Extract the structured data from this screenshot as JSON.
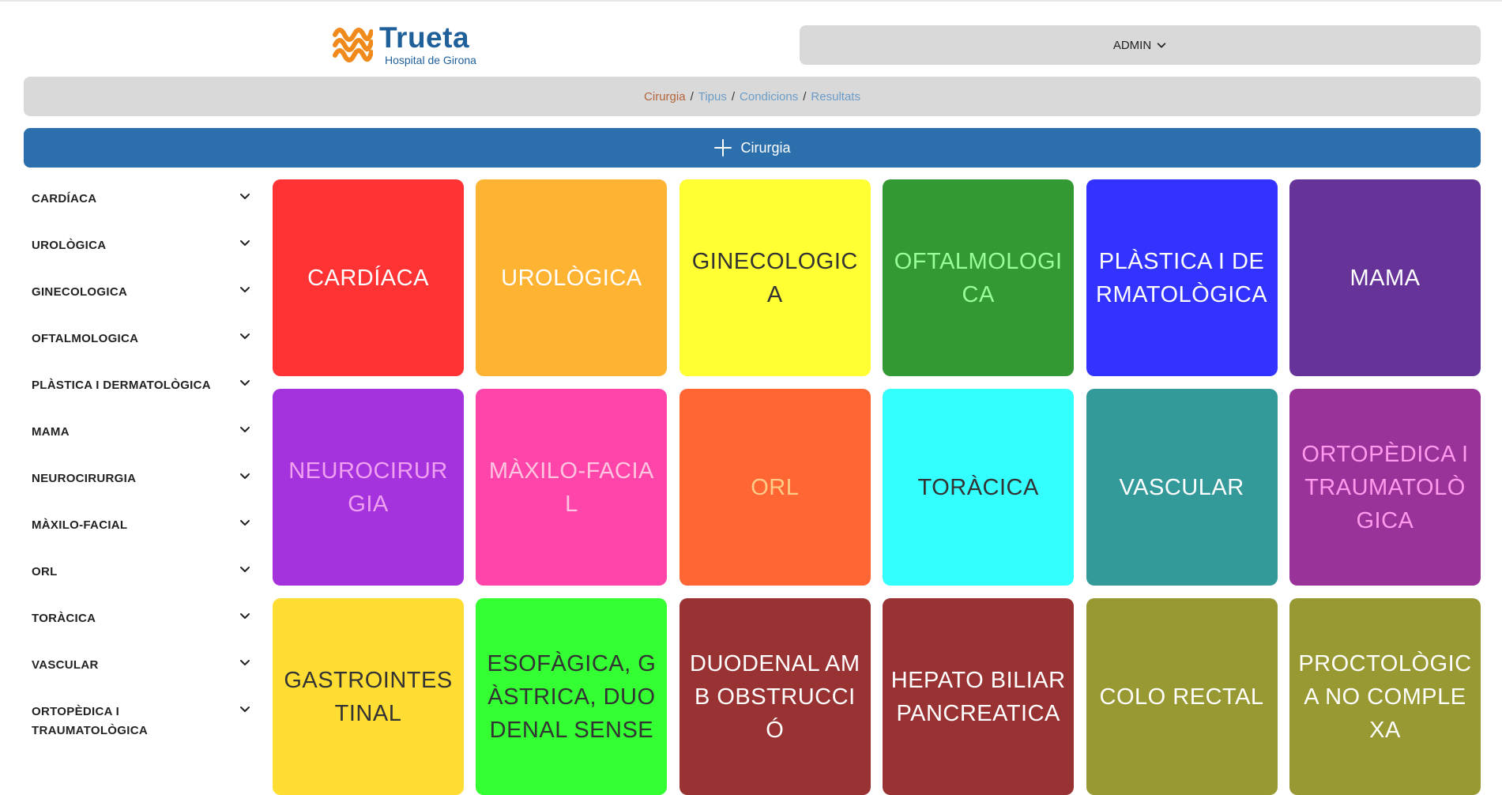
{
  "header": {
    "logo_name": "Trueta",
    "logo_subtitle": "Hospital de Girona",
    "user_label": "ADMIN"
  },
  "breadcrumb": {
    "items": [
      "Cirurgia",
      "Tipus",
      "Condicions",
      "Resultats"
    ],
    "separator": "/"
  },
  "add_button": {
    "label": "Cirurgia"
  },
  "sidebar": {
    "items": [
      {
        "label": "CARDÍACA"
      },
      {
        "label": "UROLÒGICA"
      },
      {
        "label": "GINECOLOGICA"
      },
      {
        "label": "OFTALMOLOGICA"
      },
      {
        "label": "PLÀSTICA I DERMATOLÒGICA"
      },
      {
        "label": "MAMA"
      },
      {
        "label": "NEUROCIRURGIA"
      },
      {
        "label": "MÀXILO-FACIAL"
      },
      {
        "label": "ORL"
      },
      {
        "label": "TORÀCICA"
      },
      {
        "label": "VASCULAR"
      },
      {
        "label": "ORTOPÈDICA I TRAUMATOLÒGICA"
      }
    ]
  },
  "tiles": [
    {
      "label": "CARDÍACA",
      "bg": "#ff3333",
      "fg": "#ffffff"
    },
    {
      "label": "UROLÒGICA",
      "bg": "#ffb333",
      "fg": "#ffffff"
    },
    {
      "label": "GINECOLOGICA",
      "bg": "#ffff33",
      "fg": "#333333"
    },
    {
      "label": "OFTALMOLOGICA",
      "bg": "#339933",
      "fg": "#99ff99"
    },
    {
      "label": "PLÀSTICA I DERMATOLÒGICA",
      "bg": "#3333ff",
      "fg": "#ffffff"
    },
    {
      "label": "MAMA",
      "bg": "#663399",
      "fg": "#ffffff"
    },
    {
      "label": "NEUROCIRURGIA",
      "bg": "#a533dd",
      "fg": "#f0a0f0"
    },
    {
      "label": "MÀXILO-FACIAL",
      "bg": "#ff44aa",
      "fg": "#ffc4e0"
    },
    {
      "label": "ORL",
      "bg": "#ff6633",
      "fg": "#ffcc88"
    },
    {
      "label": "TORÀCICA",
      "bg": "#33ffff",
      "fg": "#333333"
    },
    {
      "label": "VASCULAR",
      "bg": "#339999",
      "fg": "#ffffff"
    },
    {
      "label": "ORTOPÈDICA I TRAUMATOLÒGICA",
      "bg": "#993399",
      "fg": "#ff99ee"
    },
    {
      "label": "GASTROINTESTINAL",
      "bg": "#ffdd33",
      "fg": "#333333"
    },
    {
      "label": "ESOFÀGICA, GÀSTRICA, DUODENAL SENSE",
      "bg": "#33ff33",
      "fg": "#333333"
    },
    {
      "label": "DUODENAL AMB OBSTRUCCIÓ",
      "bg": "#993333",
      "fg": "#ffffff"
    },
    {
      "label": "HEPATO BILIAR PANCREATICA",
      "bg": "#993333",
      "fg": "#ffffff"
    },
    {
      "label": "COLO RECTAL",
      "bg": "#999933",
      "fg": "#ffffff"
    },
    {
      "label": "PROCTOLÒGICA NO COMPLEXA",
      "bg": "#999933",
      "fg": "#ffffff"
    }
  ]
}
